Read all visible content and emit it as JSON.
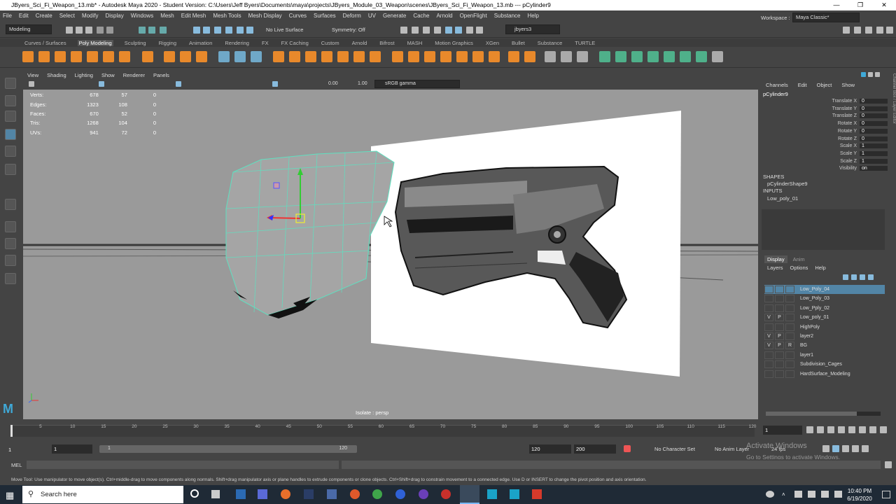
{
  "window": {
    "title": "JByers_Sci_Fi_Weapon_13.mb* - Autodesk Maya 2020 - Student Version: C:\\Users\\Jeff Byers\\Documents\\maya\\projects\\JByers_Module_03_Weapon\\scenes\\JByers_Sci_Fi_Weapon_13.mb  ---  pCylinder9"
  },
  "menu": [
    "File",
    "Edit",
    "Create",
    "Select",
    "Modify",
    "Display",
    "Windows",
    "Mesh",
    "Edit Mesh",
    "Mesh Tools",
    "Mesh Display",
    "Curves",
    "Surfaces",
    "Deform",
    "UV",
    "Generate",
    "Cache",
    "Arnold",
    "OpenFlight",
    "Substance",
    "Help"
  ],
  "status": {
    "mode": "Modeling",
    "live_surface": "No Live Surface",
    "symmetry": "Symmetry: Off",
    "user": "jbyers3",
    "workspace_label": "Workspace :",
    "workspace": "Maya Classic*"
  },
  "shelf_tabs": [
    "Curves / Surfaces",
    "Poly Modeling",
    "Sculpting",
    "Rigging",
    "Animation",
    "Rendering",
    "FX",
    "FX Caching",
    "Custom",
    "Arnold",
    "Bifrost",
    "MASH",
    "Motion Graphics",
    "XGen",
    "Bullet",
    "Substance",
    "TURTLE"
  ],
  "viewport": {
    "menu": [
      "View",
      "Shading",
      "Lighting",
      "Show",
      "Renderer",
      "Panels"
    ],
    "exposure": "0.00",
    "gamma": "1.00",
    "colorspace": "sRGB gamma",
    "hud": [
      {
        "k": "Verts:",
        "a": "678",
        "b": "57",
        "c": "0"
      },
      {
        "k": "Edges:",
        "a": "1323",
        "b": "108",
        "c": "0"
      },
      {
        "k": "Faces:",
        "a": "670",
        "b": "52",
        "c": "0"
      },
      {
        "k": "Tris:",
        "a": "1268",
        "b": "104",
        "c": "0"
      },
      {
        "k": "UVs:",
        "a": "941",
        "b": "72",
        "c": "0"
      }
    ],
    "isolate": "Isolate : persp"
  },
  "channelbox": {
    "tabs": [
      "Channels",
      "Edit",
      "Object",
      "Show"
    ],
    "object": "pCylinder9",
    "attrs": [
      {
        "n": "Translate X",
        "v": "0"
      },
      {
        "n": "Translate Y",
        "v": "0"
      },
      {
        "n": "Translate Z",
        "v": "0"
      },
      {
        "n": "Rotate X",
        "v": "0"
      },
      {
        "n": "Rotate Y",
        "v": "0"
      },
      {
        "n": "Rotate Z",
        "v": "0"
      },
      {
        "n": "Scale X",
        "v": "1"
      },
      {
        "n": "Scale Y",
        "v": "1"
      },
      {
        "n": "Scale Z",
        "v": "1"
      },
      {
        "n": "Visibility",
        "v": "on"
      }
    ],
    "shapes_label": "SHAPES",
    "shape": "pCylinderShape9",
    "inputs_label": "INPUTS",
    "input": "Low_poly_01",
    "side_tabs": [
      "Channel Box / Layer Editor",
      "Modeling Toolkit",
      "Attribute Editor"
    ]
  },
  "layers": {
    "tabs": [
      "Display",
      "Anim"
    ],
    "menu": [
      "Layers",
      "Options",
      "Help"
    ],
    "items": [
      {
        "v": "",
        "p": "",
        "r": "",
        "name": "Low_Poly_04",
        "sel": true
      },
      {
        "v": "",
        "p": "",
        "r": "",
        "name": "Low_Poly_03"
      },
      {
        "v": "",
        "p": "",
        "r": "",
        "name": "Low_Pply_02"
      },
      {
        "v": "V",
        "p": "P",
        "r": "",
        "name": "Low_poly_01"
      },
      {
        "v": "",
        "p": "",
        "r": "",
        "name": "HighPoly"
      },
      {
        "v": "V",
        "p": "P",
        "r": "",
        "name": "layer2"
      },
      {
        "v": "V",
        "p": "P",
        "r": "R",
        "name": "BG"
      },
      {
        "v": "",
        "p": "",
        "r": "",
        "name": "layer1"
      },
      {
        "v": "",
        "p": "",
        "r": "",
        "name": "Subdivision_Cages"
      },
      {
        "v": "",
        "p": "",
        "r": "",
        "name": "HardSurface_Modeling"
      }
    ]
  },
  "timeline": {
    "ticks": [
      "5",
      "10",
      "15",
      "20",
      "25",
      "30",
      "35",
      "40",
      "45",
      "50",
      "55",
      "60",
      "65",
      "70",
      "75",
      "80",
      "85",
      "90",
      "95",
      "100",
      "105",
      "110",
      "115",
      "120"
    ],
    "current": "1",
    "start": "1",
    "start2": "1",
    "range_start": "1",
    "range_end": "120",
    "end": "120",
    "end2": "200",
    "char_set": "No Character Set",
    "anim_layer": "No Anim Layer",
    "fps": "24 fps"
  },
  "cmd": {
    "label": "MEL"
  },
  "help": "Move Tool: Use manipulator to move object(s). Ctrl+middle-drag to move components along normals. Shift+drag manipulator axis or plane handles to extrude components or clone objects. Ctrl+Shift+drag to constrain movement to a connected edge. Use D or INSERT to change the pivot position and axis orientation.",
  "activate": {
    "line1": "Activate Windows",
    "line2": "Go to Settings to activate Windows."
  },
  "taskbar": {
    "search": "Search here",
    "time": "10:40 PM",
    "date": "6/19/2020"
  },
  "colors": {
    "accent": "#5285a6",
    "wire": "#5fe0c0",
    "bg": "#444444",
    "viewport": "#9a9a9a"
  }
}
